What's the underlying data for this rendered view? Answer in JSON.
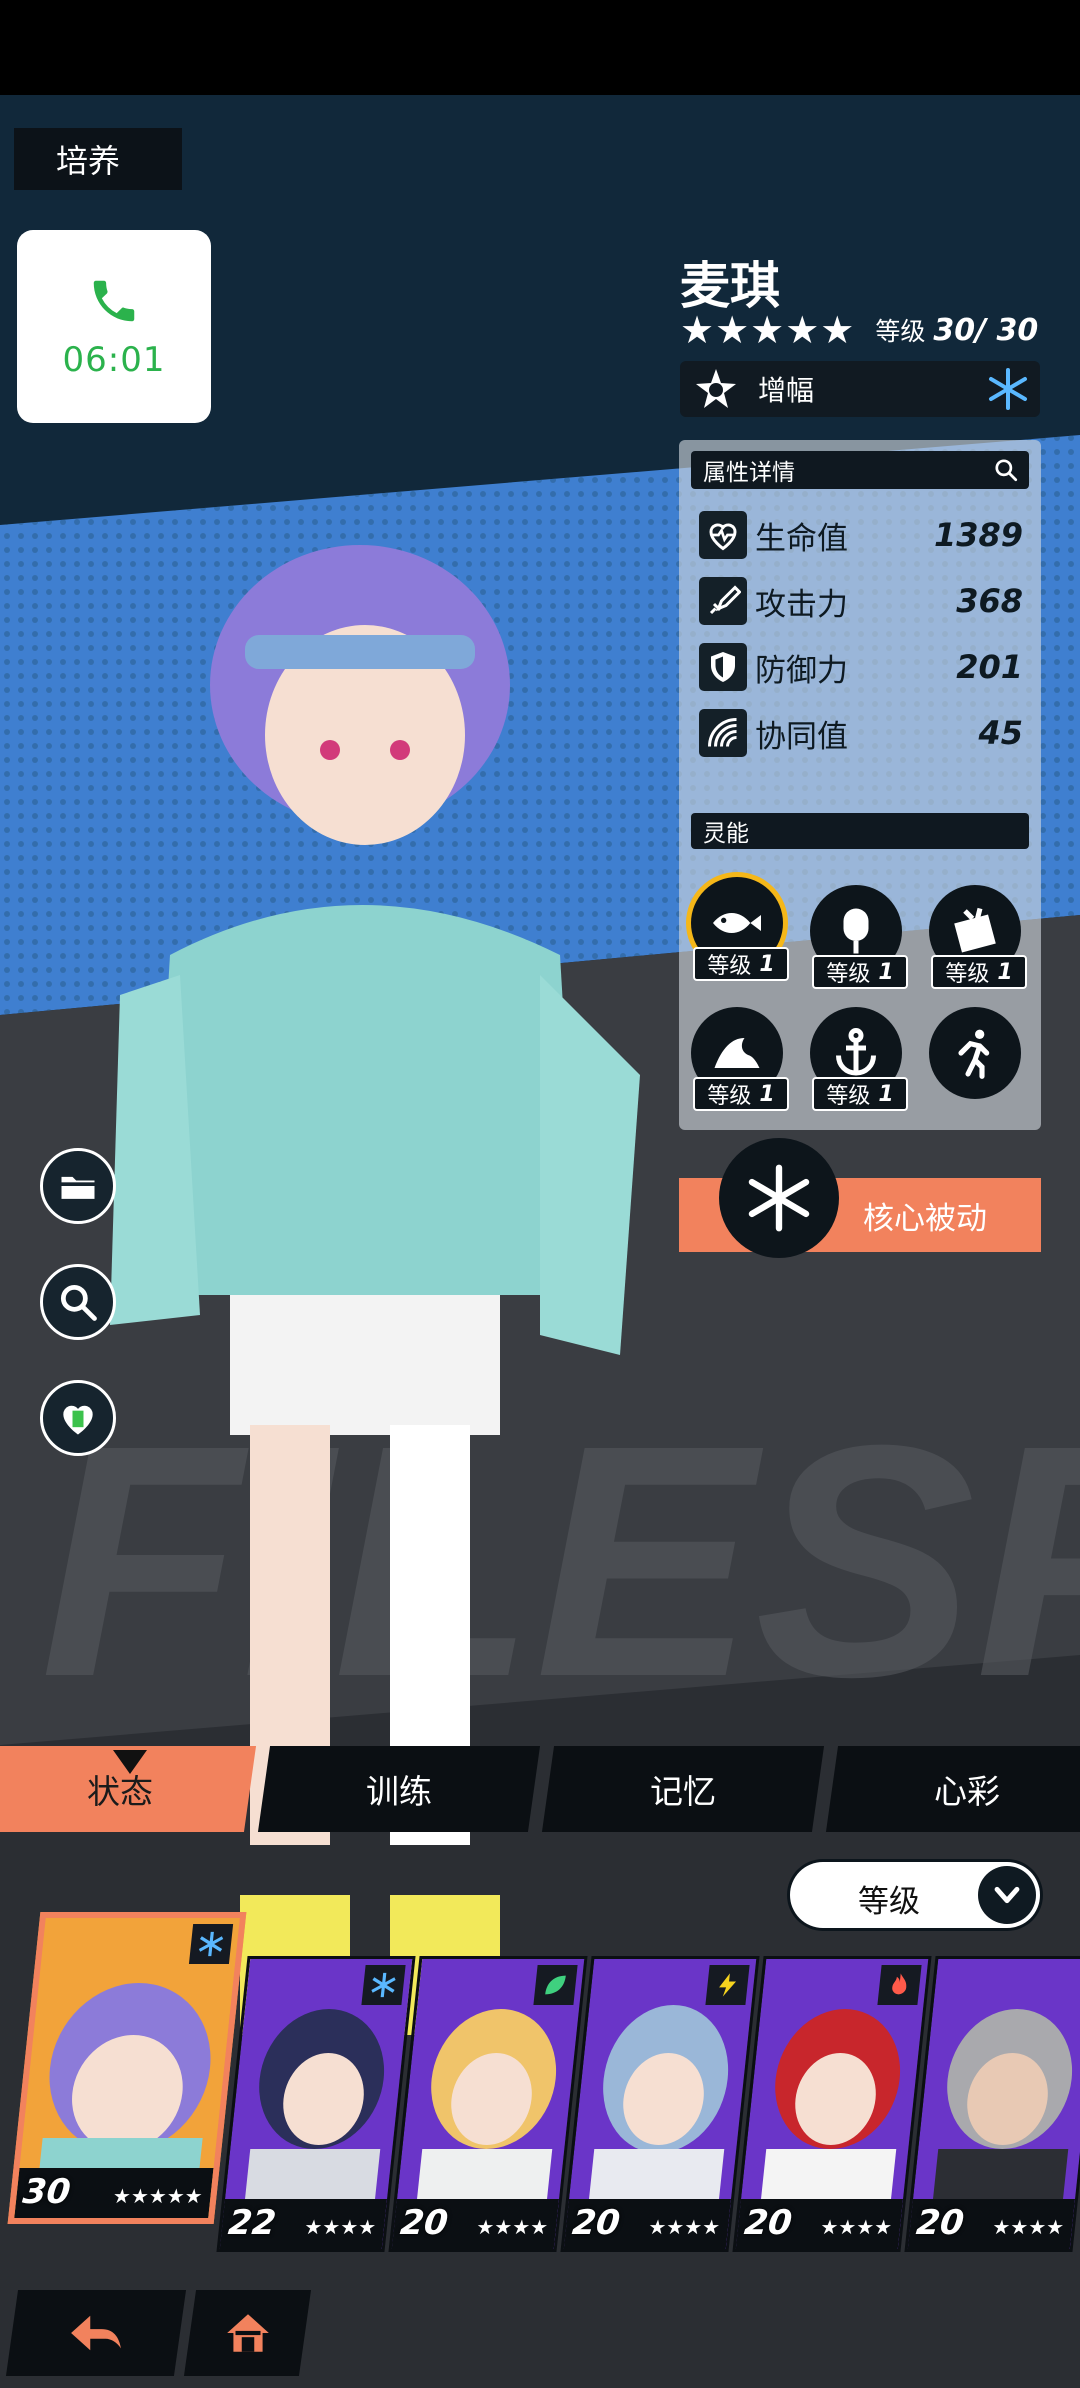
{
  "screen": {
    "title": "培养"
  },
  "call": {
    "time": "06:01"
  },
  "character": {
    "name": "麦琪",
    "stars": "★★★★★",
    "level_label": "等级",
    "level_value": "30/ 30",
    "role": "增幅",
    "element": "snowflake-icon"
  },
  "attributes": {
    "header": "属性详情",
    "rows": [
      {
        "label": "生命值",
        "value": "1389",
        "icon": "heart-icon"
      },
      {
        "label": "攻击力",
        "value": "368",
        "icon": "sword-icon"
      },
      {
        "label": "防御力",
        "value": "201",
        "icon": "shield-icon"
      },
      {
        "label": "协同值",
        "value": "45",
        "icon": "sync-icon"
      }
    ]
  },
  "skills": {
    "header": "灵能",
    "items": [
      {
        "level_label": "等级",
        "level": "1",
        "icon": "fish-icon",
        "active": true
      },
      {
        "level_label": "等级",
        "level": "1",
        "icon": "popsicle-icon"
      },
      {
        "level_label": "等级",
        "level": "1",
        "icon": "block-icon"
      },
      {
        "level_label": "等级",
        "level": "1",
        "icon": "wave-icon"
      },
      {
        "level_label": "等级",
        "level": "1",
        "icon": "anchor-icon"
      },
      {
        "icon": "runner-icon"
      }
    ]
  },
  "core": {
    "label": "核心被动"
  },
  "tabs": [
    "状态",
    "训练",
    "记忆",
    "心彩"
  ],
  "sort": {
    "label": "等级"
  },
  "roster": [
    {
      "level": "30",
      "stars": "★★★★★",
      "element": "snowflake",
      "color": "#f2a33a"
    },
    {
      "level": "22",
      "stars": "★★★★",
      "element": "snowflake",
      "color": "#6a35c8"
    },
    {
      "level": "20",
      "stars": "★★★★",
      "element": "leaf",
      "color": "#6a35c8"
    },
    {
      "level": "20",
      "stars": "★★★★",
      "element": "bolt",
      "color": "#6a35c8"
    },
    {
      "level": "20",
      "stars": "★★★★",
      "element": "flame",
      "color": "#6a35c8"
    },
    {
      "level": "20",
      "stars": "★★★★",
      "element": "none",
      "color": "#6a35c8"
    }
  ],
  "colors": {
    "accent": "#f2825d",
    "dark": "#0b0f13",
    "call_green": "#2bb24c",
    "gold": "#f5b719"
  }
}
